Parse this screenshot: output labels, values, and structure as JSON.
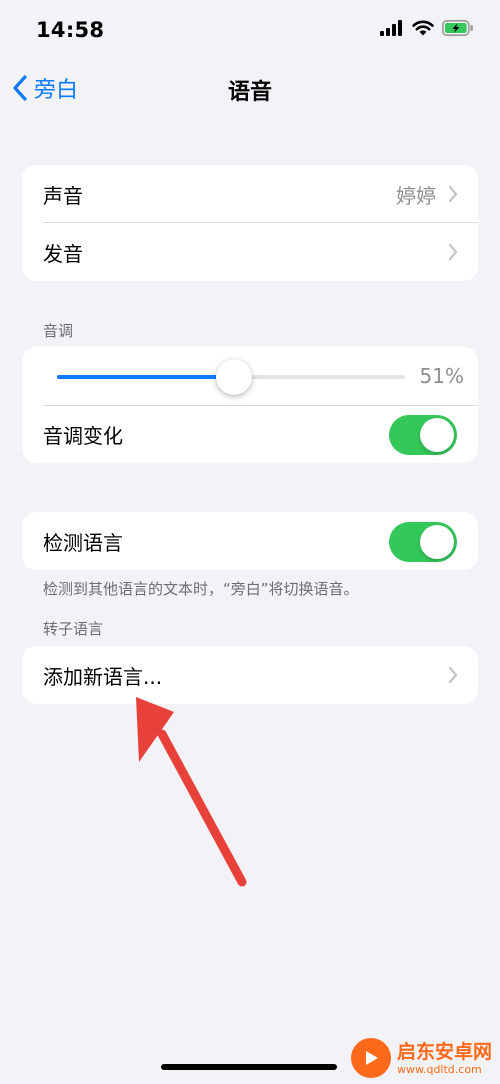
{
  "status_bar": {
    "time": "14:58",
    "icons": [
      "signal-icon",
      "wifi-icon",
      "battery-charging-icon"
    ],
    "battery_color": "#34c759"
  },
  "nav": {
    "back_label": "旁白",
    "title": "语音"
  },
  "group1": {
    "voice_label": "声音",
    "voice_value": "婷婷",
    "pronunciation_label": "发音"
  },
  "pitch": {
    "header": "音调",
    "value": 0.51,
    "value_text": "51%",
    "variation_label": "音调变化",
    "variation_on": true
  },
  "detect": {
    "label": "检测语言",
    "on": true,
    "footer": "检测到其他语言的文本时，“旁白”将切换语音。"
  },
  "rotor": {
    "header": "转子语言",
    "add_label": "添加新语言..."
  },
  "colors": {
    "accent": "#0a7aff",
    "toggle_on": "#34c759",
    "annotation_arrow": "#e8413a"
  },
  "watermark": {
    "title": "启东安卓网",
    "url": "www.qdltd.com"
  }
}
